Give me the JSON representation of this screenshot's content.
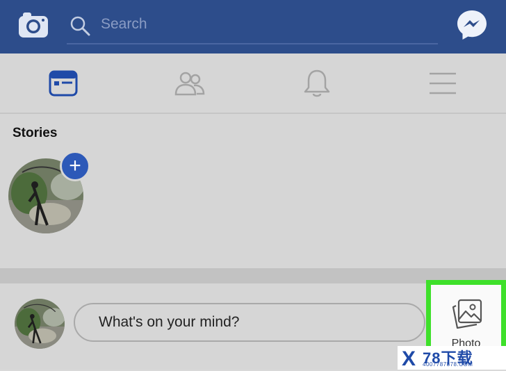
{
  "header": {
    "search_placeholder": "Search",
    "camera_icon": "camera-icon",
    "messenger_icon": "messenger-icon",
    "background_color": "#2d4d8b"
  },
  "nav": {
    "tabs": [
      {
        "icon": "news-feed-icon",
        "active": true
      },
      {
        "icon": "friends-icon",
        "active": false
      },
      {
        "icon": "notifications-bell-icon",
        "active": false
      },
      {
        "icon": "menu-icon",
        "active": false
      }
    ]
  },
  "stories": {
    "title": "Stories",
    "add_story_icon": "plus-icon"
  },
  "composer": {
    "placeholder": "What's on your mind?",
    "photo_label": "Photo",
    "photo_icon": "photo-icon",
    "highlight_color": "#3ee02a"
  },
  "watermark": {
    "brand_main": "78下载",
    "brand_sub": "4007787878.COM",
    "mark": "X"
  }
}
